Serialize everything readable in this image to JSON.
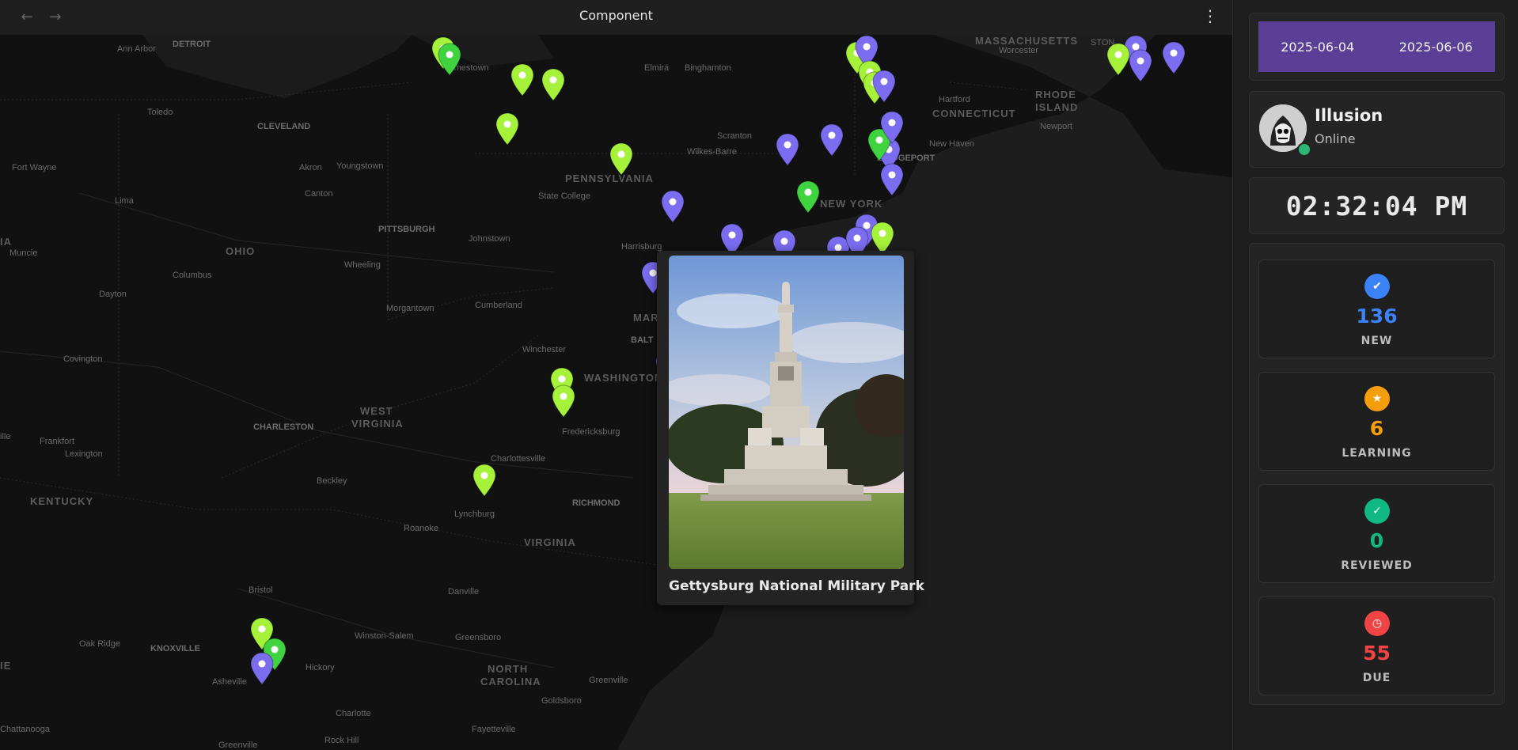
{
  "header": {
    "title": "Component",
    "back_icon": "arrow-left-icon",
    "forward_icon": "arrow-right-icon",
    "more_icon": "more-vertical-icon"
  },
  "map": {
    "labels": {
      "massachusetts": "MASSACHUSETTS",
      "worcester": "Worcester",
      "rhode_island_1": "RHODE",
      "rhode_island_2": "ISLAND",
      "hartford": "Hartford",
      "connecticut": "CONNECTICUT",
      "newport": "Newport",
      "new_haven": "New Haven",
      "bridgeport": "BRIDGEPORT",
      "new_york": "NEW YORK",
      "detroit": "DETROIT",
      "ann_arbor": "Ann Arbor",
      "toledo": "Toledo",
      "cleveland": "CLEVELAND",
      "fort_wayne": "Fort Wayne",
      "youngstown": "Youngstown",
      "akron": "Akron",
      "canton": "Canton",
      "lima": "Lima",
      "ohio": "OHIO",
      "pittsburgh": "PITTSBURGH",
      "johnstown": "Johnstown",
      "wheeling": "Wheeling",
      "columbus": "Columbus",
      "muncie": "Muncie",
      "dayton": "Dayton",
      "jamestown": "Jamestown",
      "elmira": "Elmira",
      "binghamton": "Binghamton",
      "scranton": "Scranton",
      "wilkes_barre": "Wilkes-Barre",
      "pennsylvania": "PENNSYLVANIA",
      "state_college": "State College",
      "harrisburg": "Harrisburg",
      "morgantown": "Morgantown",
      "cumberland": "Cumberland",
      "winchester": "Winchester",
      "washington": "WASHINGTON",
      "mar": "MAR",
      "balt": "BALT",
      "covington": "Covington",
      "west_virginia_1": "WEST",
      "west_virginia_2": "VIRGINIA",
      "charleston": "CHARLESTON",
      "fredericksburg": "Fredericksburg",
      "frankfort": "Frankfort",
      "lexington": "Lexington",
      "charlottesville": "Charlottesville",
      "beckley": "Beckley",
      "kentucky": "KENTUCKY",
      "richmond": "RICHMOND",
      "lynchburg": "Lynchburg",
      "roanoke": "Roanoke",
      "virginia": "VIRGINIA",
      "bristol": "Bristol",
      "danville": "Danville",
      "oak_ridge": "Oak Ridge",
      "knoxville": "KNOXVILLE",
      "winston_salem": "Winston-Salem",
      "greensboro": "Greensboro",
      "hickory": "Hickory",
      "north_carolina_1": "NORTH",
      "north_carolina_2": "CAROLINA",
      "greenville": "Greenville",
      "asheville": "Asheville",
      "goldsboro": "Goldsboro",
      "charlotte": "Charlotte",
      "chattanooga": "Chattanooga",
      "fayetteville": "Fayetteville",
      "rock_hill": "Rock Hill",
      "greenville_sc": "Greenville",
      "ia": "IA",
      "ie": "IE",
      "ille": "ille",
      "ston": "STON"
    },
    "colors": {
      "purple_pin": "#7b6cf0",
      "lime_pin": "#a6f23a",
      "green_pin": "#3fd43f"
    }
  },
  "popup": {
    "caption": "Gettysburg National Military Park",
    "image_alt": "Soldiers' National Monument at Gettysburg"
  },
  "sidebar": {
    "dates": {
      "start": "2025-06-04",
      "end": "2025-06-06"
    },
    "user": {
      "name": "Illusion",
      "status": "Online",
      "status_color": "#2bb673"
    },
    "clock": "02:32:04 PM",
    "stats": [
      {
        "value": "136",
        "label": "NEW",
        "color": "#3b82f6",
        "icon": "check-circle-icon"
      },
      {
        "value": "6",
        "label": "LEARNING",
        "color": "#f59e0b",
        "icon": "star-icon"
      },
      {
        "value": "0",
        "label": "REVIEWED",
        "color": "#10b981",
        "icon": "check-icon"
      },
      {
        "value": "55",
        "label": "DUE",
        "color": "#ef4444",
        "icon": "clock-icon"
      }
    ]
  }
}
